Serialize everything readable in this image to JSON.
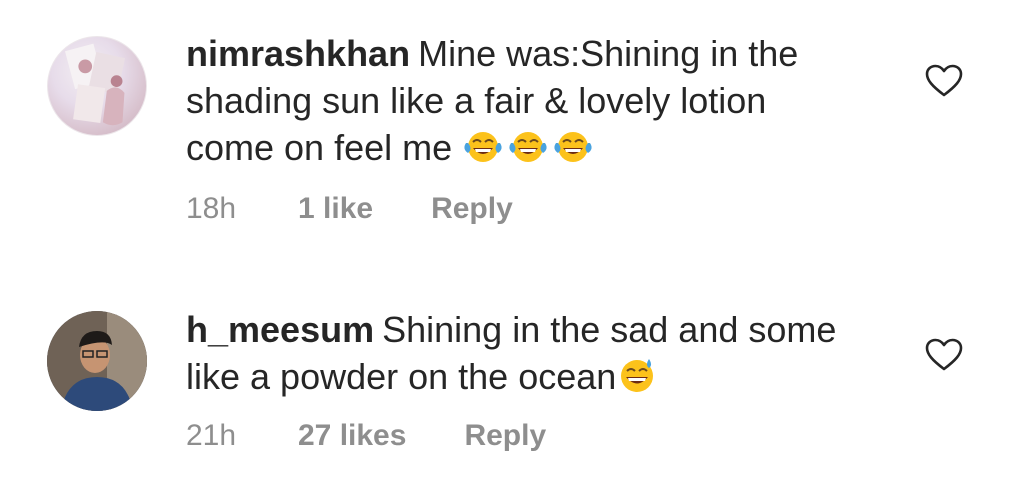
{
  "comments": [
    {
      "username": "nimrashkhan",
      "text_lines": [
        "Mine was:Shining in the",
        "shading sun like a fair & lovely lotion",
        "come on feel me"
      ],
      "emojis": [
        "face-with-tears-of-joy",
        "face-with-tears-of-joy",
        "face-with-tears-of-joy"
      ],
      "time": "18h",
      "likes": "1 like",
      "reply": "Reply"
    },
    {
      "username": "h_meesum",
      "text_lines": [
        "Shining in the sad and some",
        "like a powder on the ocean"
      ],
      "emojis": [
        "grinning-face-with-sweat"
      ],
      "time": "21h",
      "likes": "27 likes",
      "reply": "Reply"
    }
  ],
  "icons": {
    "like": "heart-outline-icon"
  },
  "colors": {
    "text": "#262626",
    "meta": "#8e8e8e",
    "background": "#ffffff"
  }
}
